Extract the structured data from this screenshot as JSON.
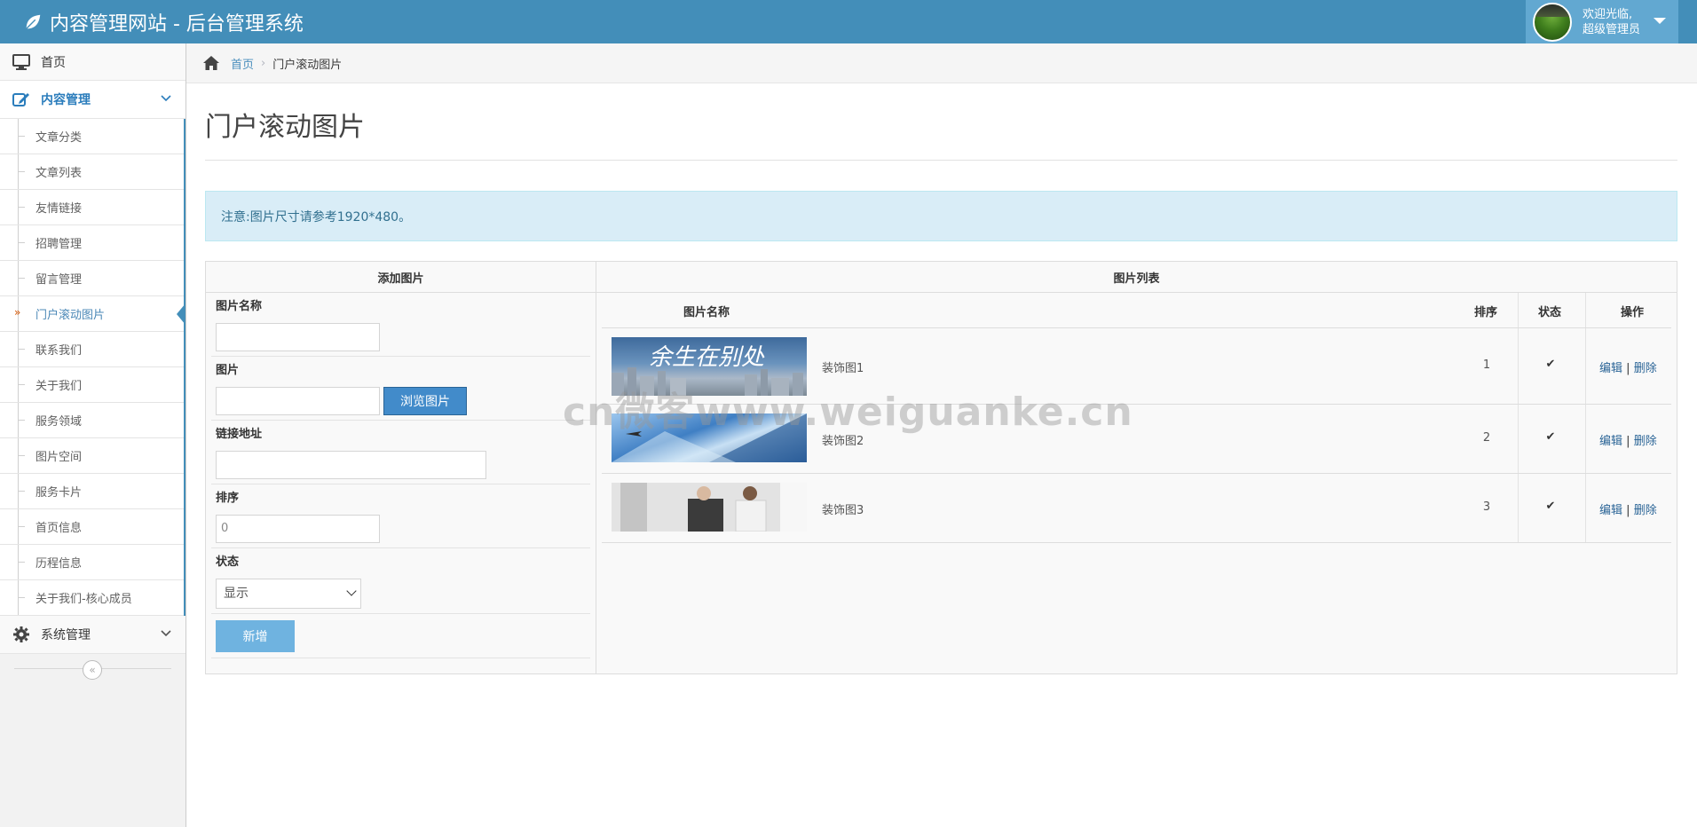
{
  "header": {
    "title": "内容管理网站 - 后台管理系统",
    "welcome": "欢迎光临,",
    "role": "超级管理员"
  },
  "sidebar": {
    "home": "首页",
    "content_group": "内容管理",
    "items": [
      {
        "label": "文章分类"
      },
      {
        "label": "文章列表"
      },
      {
        "label": "友情链接"
      },
      {
        "label": "招聘管理"
      },
      {
        "label": "留言管理"
      },
      {
        "label": "门户滚动图片",
        "active": true
      },
      {
        "label": "联系我们"
      },
      {
        "label": "关于我们"
      },
      {
        "label": "服务领域"
      },
      {
        "label": "图片空间"
      },
      {
        "label": "服务卡片"
      },
      {
        "label": "首页信息"
      },
      {
        "label": "历程信息"
      },
      {
        "label": "关于我们-核心成员"
      }
    ],
    "system_group": "系统管理",
    "collapse_glyph": "«"
  },
  "breadcrumb": {
    "home": "首页",
    "current": "门户滚动图片"
  },
  "page": {
    "title": "门户滚动图片",
    "notice": "注意:图片尺寸请参考1920*480。"
  },
  "form": {
    "heading": "添加图片",
    "name_label": "图片名称",
    "name_value": "",
    "image_label": "图片",
    "image_value": "",
    "browse_label": "浏览图片",
    "link_label": "链接地址",
    "link_value": "",
    "order_label": "排序",
    "order_value": "0",
    "status_label": "状态",
    "status_value": "显示",
    "submit_label": "新增"
  },
  "list": {
    "heading": "图片列表",
    "columns": {
      "name": "图片名称",
      "order": "排序",
      "status": "状态",
      "ops": "操作"
    },
    "rows": [
      {
        "thumb_text": "余生在别处",
        "name": "装饰图1",
        "order": "1",
        "edit": "编辑",
        "sep": "|",
        "delete": "删除"
      },
      {
        "thumb_text": "",
        "name": "装饰图2",
        "order": "2",
        "edit": "编辑",
        "sep": "|",
        "delete": "删除"
      },
      {
        "thumb_text": "",
        "name": "装饰图3",
        "order": "3",
        "edit": "编辑",
        "sep": "|",
        "delete": "删除"
      }
    ]
  },
  "watermark": "cn微客www.weiguanke.cn",
  "colors": {
    "navbar": "#438eb9",
    "user_box": "#62a8d1",
    "link": "#2a6496",
    "alert_bg": "#d9edf7",
    "primary_button": "#428bca",
    "submit_button": "#6fb3e0"
  }
}
